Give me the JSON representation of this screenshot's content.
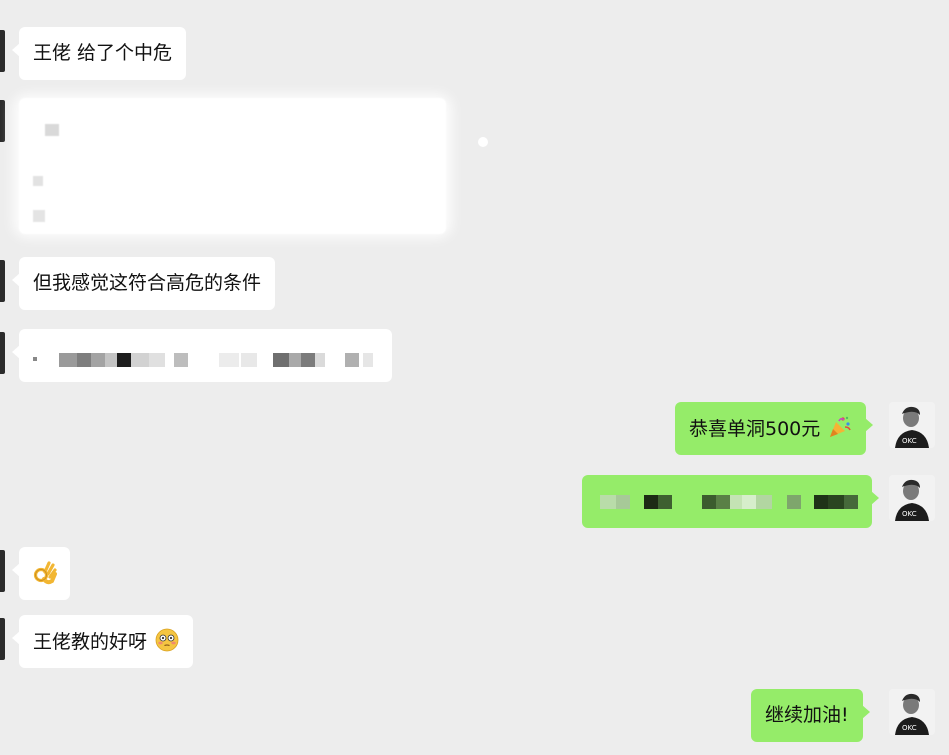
{
  "messages": [
    {
      "id": "m1",
      "side": "in",
      "text": "王佬 给了个中危"
    },
    {
      "id": "m2",
      "side": "in",
      "text": "",
      "redacted": true
    },
    {
      "id": "m3",
      "side": "in",
      "text": "但我感觉这符合高危的条件"
    },
    {
      "id": "m4",
      "side": "in",
      "text": "",
      "redacted": true
    },
    {
      "id": "m5",
      "side": "out",
      "text": "恭喜单洞500元",
      "emoji": "party-popper-icon"
    },
    {
      "id": "m6",
      "side": "out",
      "text": "",
      "redacted": true
    },
    {
      "id": "m7",
      "side": "in",
      "text": "",
      "emoji": "ok-hand-icon"
    },
    {
      "id": "m8",
      "side": "in",
      "text": "王佬教的好呀",
      "emoji": "flushed-face-icon"
    },
    {
      "id": "m9",
      "side": "out",
      "text": "继续加油!"
    }
  ],
  "me": {
    "avatar_label": "OKC"
  },
  "colors": {
    "background": "#ededed",
    "incoming_bubble": "#ffffff",
    "outgoing_bubble": "#95ec69"
  }
}
